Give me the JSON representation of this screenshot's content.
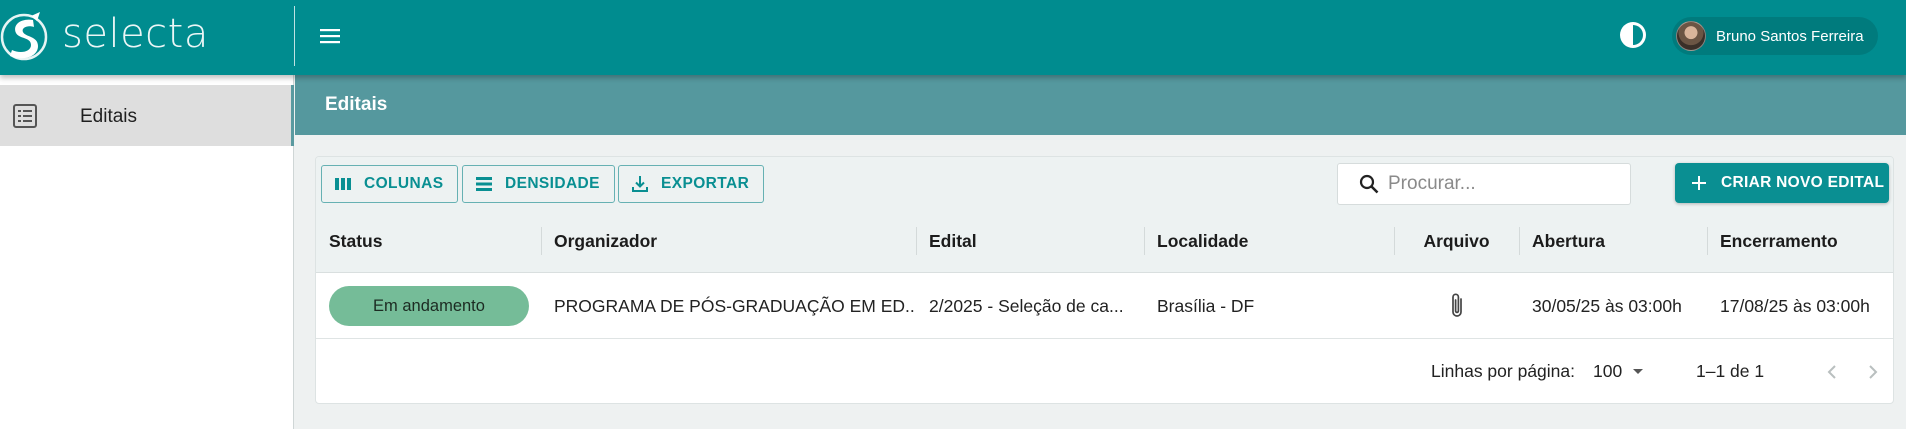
{
  "app": {
    "logo_text": "selecta",
    "user_name": "Bruno Santos Ferreira"
  },
  "sidebar": {
    "items": [
      {
        "label": "Editais",
        "icon": "list-icon",
        "active": true
      }
    ]
  },
  "page": {
    "title": "Editais"
  },
  "toolbar": {
    "columns_label": "COLUNAS",
    "density_label": "DENSIDADE",
    "export_label": "EXPORTAR",
    "search_placeholder": "Procurar...",
    "search_value": "",
    "create_label": "CRIAR NOVO EDITAL"
  },
  "table": {
    "columns": [
      "Status",
      "Organizador",
      "Edital",
      "Localidade",
      "Arquivo",
      "Abertura",
      "Encerramento"
    ],
    "rows": [
      {
        "status": "Em andamento",
        "organizador": "PROGRAMA DE PÓS-GRADUAÇÃO EM ED...",
        "edital": "2/2025 - Seleção de ca...",
        "localidade": "Brasília - DF",
        "arquivo_icon": "paperclip-icon",
        "abertura": "30/05/25 às 03:00h",
        "encerramento": "17/08/25 às 03:00h"
      }
    ]
  },
  "pagination": {
    "rows_per_page_label": "Linhas por página:",
    "rows_per_page_value": "100",
    "range_label": "1–1 de 1"
  },
  "colors": {
    "appbar": "#008c8f",
    "page_header": "#55989e",
    "accent": "#0a8f92",
    "status_in_progress": "#75bc98"
  }
}
